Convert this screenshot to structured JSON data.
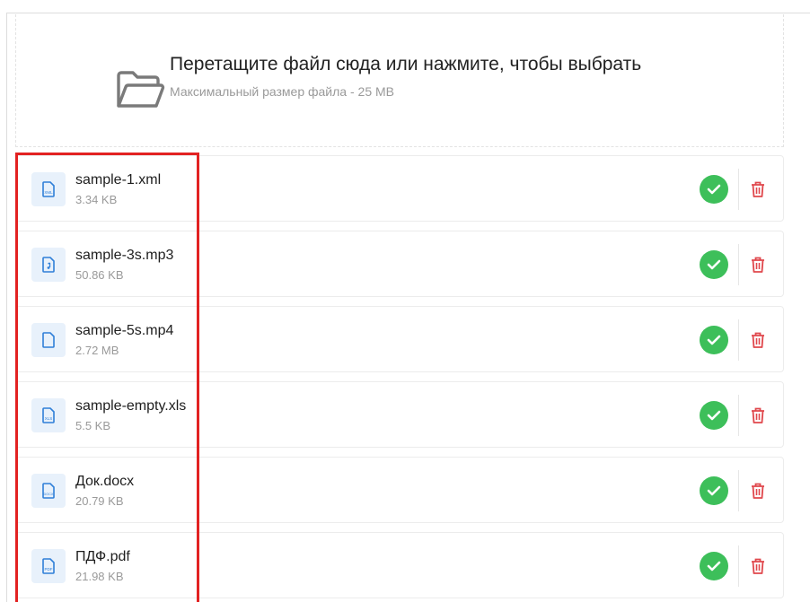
{
  "dropzone": {
    "title": "Перетащите файл сюда или нажмите, чтобы выбрать",
    "subtitle": "Максимальный размер файла - 25 MB",
    "icon": "folder-icon"
  },
  "files": [
    {
      "name": "sample-1.xml",
      "size": "3.34 KB",
      "icon": "xml-file-icon",
      "icon_tag": "XML"
    },
    {
      "name": "sample-3s.mp3",
      "size": "50.86 KB",
      "icon": "audio-file-icon",
      "icon_tag": ""
    },
    {
      "name": "sample-5s.mp4",
      "size": "2.72 MB",
      "icon": "file-icon",
      "icon_tag": ""
    },
    {
      "name": "sample-empty.xls",
      "size": "5.5 KB",
      "icon": "xls-file-icon",
      "icon_tag": "XLS"
    },
    {
      "name": "Док.docx",
      "size": "20.79 KB",
      "icon": "docx-file-icon",
      "icon_tag": "DOCX"
    },
    {
      "name": "ПДФ.pdf",
      "size": "21.98 KB",
      "icon": "pdf-file-icon",
      "icon_tag": "PDF"
    }
  ],
  "status_icon": "check-circle-icon",
  "delete_icon": "trash-icon",
  "colors": {
    "success": "#3dbf5a",
    "delete": "#e0474c",
    "highlight": "#e22222",
    "icon_bg": "#e8f1fb",
    "icon_fg": "#2f7fd8"
  }
}
